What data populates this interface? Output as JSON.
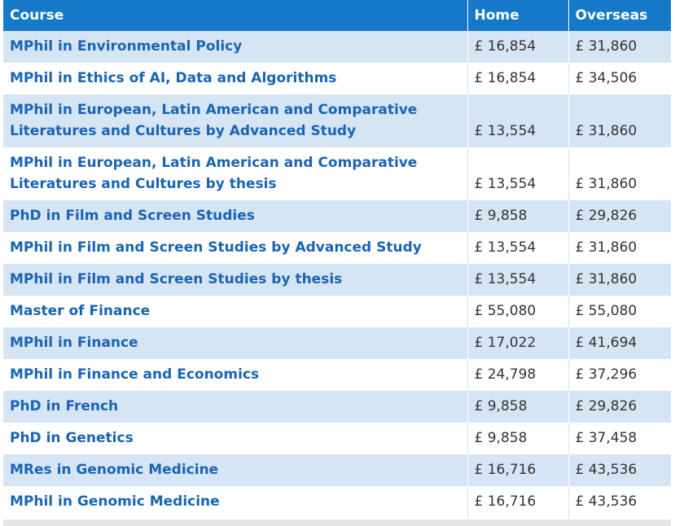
{
  "table": {
    "headers": {
      "course": "Course",
      "home": "Home",
      "overseas": "Overseas"
    },
    "rows": [
      {
        "course": "MPhil in Environmental Policy",
        "home": "£ 16,854",
        "overseas": "£ 31,860"
      },
      {
        "course": "MPhil in Ethics of AI, Data and Algorithms",
        "home": "£ 16,854",
        "overseas": "£ 34,506"
      },
      {
        "course": "MPhil in European, Latin American and Comparative Literatures and Cultures by Advanced Study",
        "home": "£ 13,554",
        "overseas": "£ 31,860"
      },
      {
        "course": "MPhil in European, Latin American and Comparative Literatures and Cultures by thesis",
        "home": "£ 13,554",
        "overseas": "£ 31,860"
      },
      {
        "course": "PhD in Film and Screen Studies",
        "home": "£ 9,858",
        "overseas": "£ 29,826"
      },
      {
        "course": "MPhil in Film and Screen Studies by Advanced Study",
        "home": "£ 13,554",
        "overseas": "£ 31,860"
      },
      {
        "course": "MPhil in Film and Screen Studies by thesis",
        "home": "£ 13,554",
        "overseas": "£ 31,860"
      },
      {
        "course": "Master of Finance",
        "home": "£ 55,080",
        "overseas": "£ 55,080"
      },
      {
        "course": "MPhil in Finance",
        "home": "£ 17,022",
        "overseas": "£ 41,694"
      },
      {
        "course": "MPhil in Finance and Economics",
        "home": "£ 24,798",
        "overseas": "£ 37,296"
      },
      {
        "course": "PhD in French",
        "home": "£ 9,858",
        "overseas": "£ 29,826"
      },
      {
        "course": "PhD in Genetics",
        "home": "£ 9,858",
        "overseas": "£ 37,458"
      },
      {
        "course": "MRes in Genomic Medicine",
        "home": "£ 16,716",
        "overseas": "£ 43,536"
      },
      {
        "course": "MPhil in Genomic Medicine",
        "home": "£ 16,716",
        "overseas": "£ 43,536"
      }
    ]
  },
  "colors": {
    "header_bg": "#1578c9",
    "row_alt_bg": "#d6e5f3",
    "link": "#1a64b4"
  }
}
